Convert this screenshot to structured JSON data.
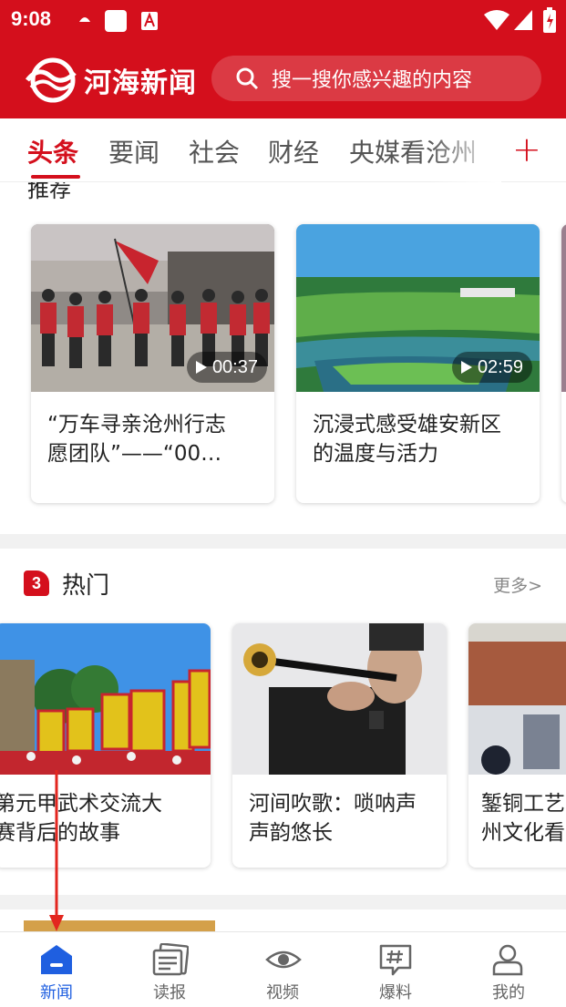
{
  "status_bar": {
    "time": "9:08"
  },
  "app": {
    "name": "河海新闻"
  },
  "search": {
    "placeholder": "搜一搜你感兴趣的内容"
  },
  "tabs": [
    {
      "label": "头条",
      "active": true
    },
    {
      "label": "要闻"
    },
    {
      "label": "社会"
    },
    {
      "label": "财经"
    },
    {
      "label": "央媒看沧州"
    }
  ],
  "add_tab_symbol": "+",
  "recommend": {
    "title": "推荐",
    "cards": [
      {
        "duration": "00:37",
        "caption_line1": "“万车寻亲沧州行志",
        "caption_line2": "愿团队”——“00…"
      },
      {
        "duration": "02:59",
        "caption_line1": "沉浸式感受雄安新区",
        "caption_line2": "的温度与活力"
      }
    ]
  },
  "hot": {
    "badge": "3",
    "title": "热门",
    "more": "更多>",
    "cards": [
      {
        "caption_line1": "第元甲武术交流大",
        "caption_line2": "赛背后的故事"
      },
      {
        "caption_line1": "河间吹歌：唢呐声",
        "caption_line2": "声韵悠长"
      },
      {
        "caption_line1": "錾铜工艺",
        "caption_line2": "州文化看"
      }
    ]
  },
  "bottom_nav": [
    {
      "label": "新闻",
      "icon": "news-home-icon",
      "active": true
    },
    {
      "label": "读报",
      "icon": "newspaper-icon"
    },
    {
      "label": "视频",
      "icon": "eye-icon"
    },
    {
      "label": "爆料",
      "icon": "hashtag-chat-icon"
    },
    {
      "label": "我的",
      "icon": "user-icon"
    }
  ],
  "colors": {
    "brand_red": "#d40f1c",
    "nav_active": "#1f5fe0"
  }
}
